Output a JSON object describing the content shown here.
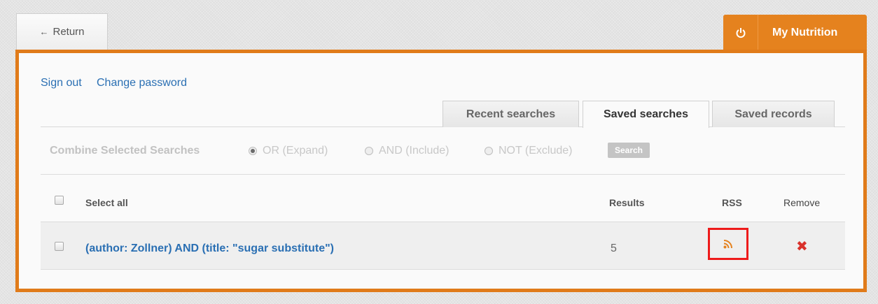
{
  "header": {
    "return_label": "Return",
    "return_icon": "arrow-left-icon",
    "my_nutrition_label": "My Nutrition",
    "my_nutrition_icon": "power-icon"
  },
  "account": {
    "sign_out": "Sign out",
    "change_password": "Change password"
  },
  "tabs": [
    {
      "label": "Recent searches",
      "active": false
    },
    {
      "label": "Saved searches",
      "active": true
    },
    {
      "label": "Saved records",
      "active": false
    }
  ],
  "combine": {
    "label": "Combine Selected Searches",
    "options": [
      {
        "label": "OR (Expand)",
        "checked": true
      },
      {
        "label": "AND (Include)",
        "checked": false
      },
      {
        "label": "NOT (Exclude)",
        "checked": false
      }
    ],
    "search_button": "Search"
  },
  "table": {
    "headers": {
      "select_all": "Select all",
      "results": "Results",
      "rss": "RSS",
      "remove": "Remove"
    },
    "rows": [
      {
        "query": "(author: Zollner) AND (title: \"sugar substitute\")",
        "results": "5",
        "rss_icon": "rss-feed-icon",
        "remove_icon": "close-x-icon"
      }
    ]
  },
  "colors": {
    "accent_orange": "#e5821e",
    "panel_border": "#e07b1a",
    "link_blue": "#2a6fb3",
    "remove_red": "#d9322c",
    "highlight_box": "#ee1b1b"
  }
}
